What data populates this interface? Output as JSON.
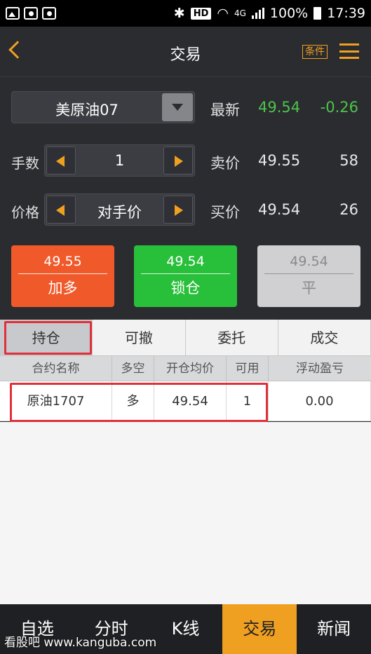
{
  "status_bar": {
    "network": "4G",
    "hd": "HD",
    "battery": "100%",
    "time": "17:39"
  },
  "header": {
    "title": "交易",
    "condition_button": "条件"
  },
  "trade": {
    "symbol": "美原油07",
    "quantity_label": "手数",
    "quantity_value": "1",
    "price_label": "价格",
    "price_value": "对手价",
    "latest_label": "最新",
    "latest_price": "49.54",
    "latest_change": "-0.26",
    "ask_label": "卖价",
    "ask_price": "49.55",
    "ask_volume": "58",
    "bid_label": "买价",
    "bid_price": "49.54",
    "bid_volume": "26"
  },
  "actions": {
    "buy": {
      "price": "49.55",
      "label": "加多"
    },
    "lock": {
      "price": "49.54",
      "label": "锁仓"
    },
    "close": {
      "price": "49.54",
      "label": "平"
    }
  },
  "tabs": [
    "持仓",
    "可撤",
    "委托",
    "成交"
  ],
  "positions": {
    "headers": [
      "合约名称",
      "多空",
      "开仓均价",
      "可用",
      "浮动盈亏"
    ],
    "rows": [
      [
        "原油1707",
        "多",
        "49.54",
        "1",
        "0.00"
      ]
    ]
  },
  "bottom_nav": [
    "自选",
    "分时",
    "K线",
    "交易",
    "新闻"
  ],
  "watermark": "看股吧 www.kanguba.com",
  "colors": {
    "accent": "#f0a020",
    "buy": "#f05a2a",
    "lock": "#28bf3a",
    "up_green": "#4cc44a",
    "highlight_red": "#e0303a"
  }
}
